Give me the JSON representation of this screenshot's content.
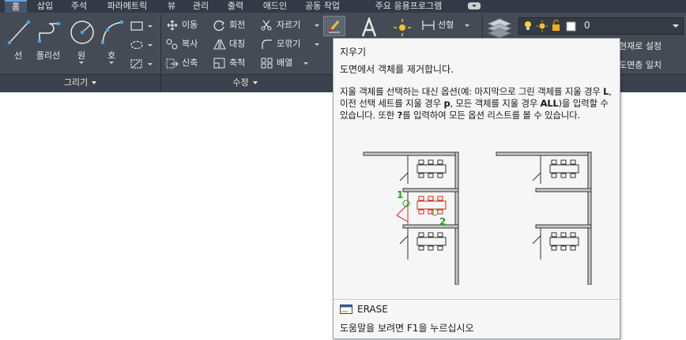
{
  "tabs": [
    {
      "label": "홈",
      "active": true
    },
    {
      "label": "삽입"
    },
    {
      "label": "주석"
    },
    {
      "label": "파라메트릭"
    },
    {
      "label": "뷰"
    },
    {
      "label": "관리"
    },
    {
      "label": "출력"
    },
    {
      "label": "애드인"
    },
    {
      "label": "공동 작업"
    },
    {
      "label": "주요 응용프로그램"
    }
  ],
  "draw_panel": {
    "title": "그리기",
    "tools": {
      "line": "선",
      "polyline": "폴리선",
      "circle": "원",
      "arc": "호"
    }
  },
  "modify_panel": {
    "title": "수정",
    "tools": {
      "move": "이동",
      "rotate": "회전",
      "trim": "자르기",
      "copy": "복사",
      "mirror": "대칭",
      "fillet": "모깎기",
      "stretch": "신축",
      "scale": "축척",
      "array": "배열"
    }
  },
  "annotation": {
    "linear": "선형"
  },
  "layers": {
    "current_layer": "0",
    "make_current": "현재로 설정",
    "match_layer": "도면층 일치"
  },
  "tooltip": {
    "title": "지우기",
    "subtitle": "도면에서 객체를 제거합니다.",
    "body": {
      "p1": "지울 객체를 선택하는 대신 옵션(예: 마지막으로 그린 객체를 지울 경우 ",
      "k1": "L",
      "p2": ", 이전 선택 세트를 지울 경우 ",
      "k2": "p",
      "p3": ", 모든 객체를 지울 경우 ",
      "k3": "ALL",
      "p4": ")을 입력할 수 있습니다. 또한 ",
      "k4": "?",
      "p5": "를 입력하여 모든 옵션 리스트를 볼 수 있습니다."
    },
    "callout_1": "1",
    "callout_2": "2",
    "command": "ERASE",
    "help": "도움말을 보려면 F1을 누르십시오"
  },
  "colors": {
    "ribbon": "#444b55",
    "tabbar": "#313a46",
    "accent_blue": "#4aa3df",
    "erase_red": "#e02020",
    "callout_green": "#22a022"
  }
}
